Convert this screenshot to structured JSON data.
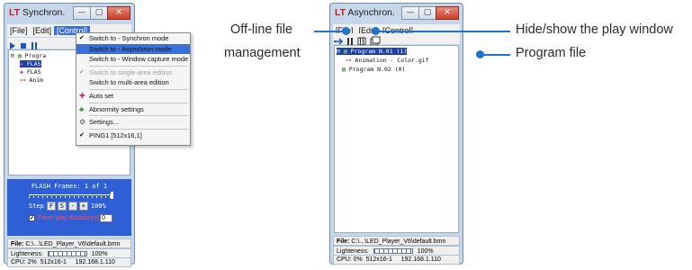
{
  "sync": {
    "title": "Synchron.",
    "menubar": [
      "[File]",
      "[Edit]",
      "[Control]"
    ],
    "tree": [
      "Progra",
      "FLAS",
      "FLAS",
      "Anim"
    ],
    "dropdown": [
      {
        "label": "Switch to - Synchron mode",
        "check": true
      },
      {
        "label": "Switch to - Asynchron mode",
        "highlight": true
      },
      {
        "label": "Switch to - Window capture mode"
      },
      {
        "label": "Switch to single-area edition",
        "check": true,
        "disabled": true
      },
      {
        "label": "Switch to multi-area edition"
      },
      {
        "label": "Auto set",
        "icon": "puzzle-icon"
      },
      {
        "label": "Abnormity settings",
        "icon": "tree-icon"
      },
      {
        "label": "Settings...",
        "icon": "settings-icon"
      },
      {
        "label": "PING1    [512x16,1]",
        "check": true
      }
    ],
    "flash_frames": "FLASH Frames: 1 of 1",
    "step_label": "Step",
    "step_buttons": [
      "F",
      "S",
      "-",
      "+"
    ],
    "step_percent": "100%",
    "force_duration_label": "Force play duration(s)",
    "force_duration_value": "0",
    "file_label": "File:",
    "file_path": "C:\\...\\LED_Player_V6\\default.bmn",
    "lightness_label": "Lighteness:",
    "lightness_value": "100%",
    "cpu": "CPU: 2%",
    "resolution": "512x16-1",
    "ip": "192.168.1.110"
  },
  "async": {
    "title": "Asynchron.",
    "menubar": [
      "[File]",
      "[Edit]",
      "[Control]"
    ],
    "tree": [
      {
        "label": "Program N.01 (1)",
        "selected": true
      },
      {
        "label": "Animation - Color.gif"
      },
      {
        "label": "Program N.02 (0)"
      }
    ],
    "file_label": "File:",
    "file_path": "C:\\...\\LED_Player_V6\\default.bmn",
    "lightness_label": "Lighteness:",
    "lightness_value": "100%",
    "cpu": "CPU: 0%",
    "resolution": "512x16-1",
    "ip": "192.168.1.110"
  },
  "callouts": {
    "offline": [
      "Off-line file",
      "management"
    ],
    "hide_show": "Hide/show the play window",
    "program_file": "Program file"
  },
  "colors": {
    "accent": "#1f73c8",
    "panel_blue": "#2f5fd6",
    "highlight": "#3a6fd8"
  }
}
